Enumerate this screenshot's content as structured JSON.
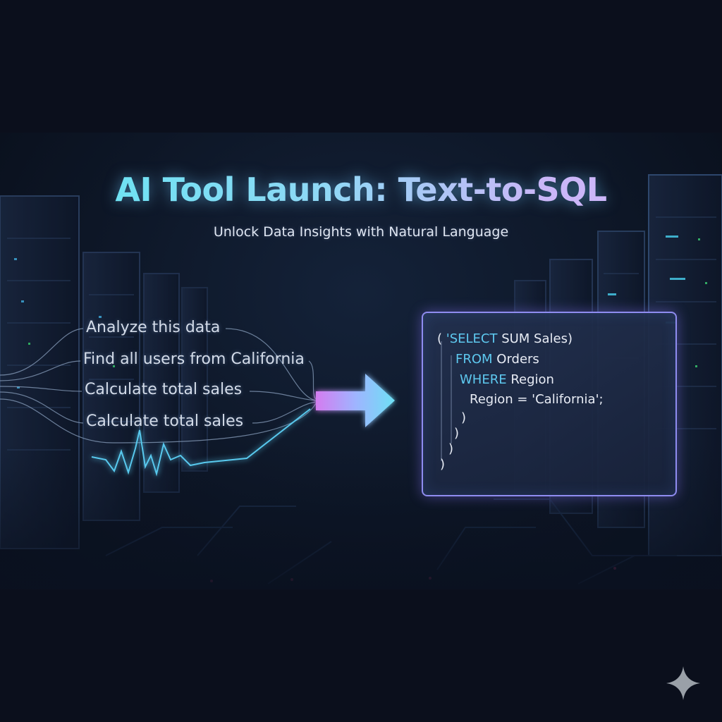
{
  "title": "AI Tool Launch: Text-to-SQL",
  "subtitle": "Unlock Data Insights with Natural Language",
  "prompts": [
    "Analyze this data",
    "Find all users from California",
    "Calculate total sales",
    "Calculate total sales"
  ],
  "code": {
    "line1_open": "(",
    "line1_kw": "'SELECT",
    "line1_rest": " SUM Sales)",
    "line2_kw": "FROM",
    "line2_rest": " Orders",
    "line3_kw": "WHERE",
    "line3_rest": " Region",
    "line4": "Region = 'California';",
    "close1": ")",
    "close2": ")",
    "close3": ")",
    "close4": ")"
  },
  "colors": {
    "accent_cyan": "#5ee7f2",
    "accent_violet": "#c9b6f7",
    "keyword": "#5ec9f0",
    "panel_border": "#8f8cf0"
  },
  "icons": {
    "transform_arrow": "arrow-right-icon",
    "brand_mark": "sparkle-icon"
  }
}
